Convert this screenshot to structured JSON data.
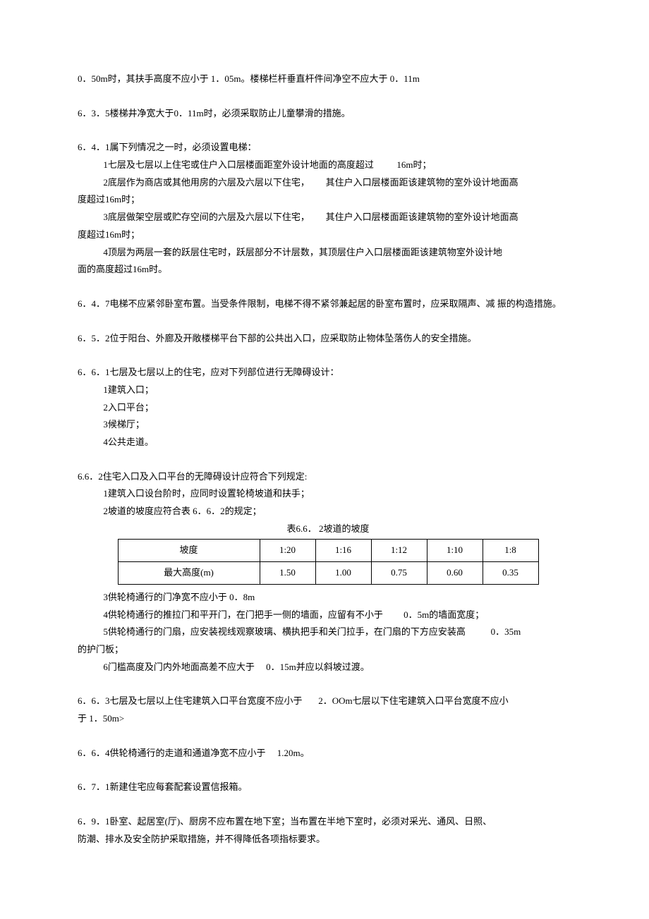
{
  "p1": "0．50m时，其扶手高度不应小于 1．05m。楼梯栏杆垂直杆件间净空不应大于 0．11m",
  "p2": "6．3．5楼梯井净宽大于0．11m时，必须采取防止儿童攀滑的措施。",
  "p3_head": "6．4．1属下列情况之一时，必须设置电梯：",
  "p3_1": "1七层及七层以上住宅或住户入口层楼面距室外设计地面的高度超过          16m时；",
  "p3_2a": "2底层作为商店或其他用房的六层及六层以下住宅，       其住户入口层楼面距该建筑物的室外设计地面高",
  "p3_2b": "度超过16m时；",
  "p3_3a": "3底层做架空层或贮存空间的六层及六层以下住宅，       其住户入口层楼面距该建筑物的室外设计地面高",
  "p3_3b": "度超过16m时；",
  "p3_4a": "4顶层为两层一套的跃层住宅时，跃层部分不计层数，其顶层住户入口层楼面距该建筑物室外设计地",
  "p3_4b": "面的高度超过16m时。",
  "p4": "6．4．7电梯不应紧邻卧室布置。当受条件限制，电梯不得不紧邻兼起居的卧室布置时，应采取隔声、减 振的构造措施。",
  "p5": "6．5．2位于阳台、外廊及开敞楼梯平台下部的公共出入口，应采取防止物体坠落伤人的安全措施。",
  "p6_head": "6．6．1七层及七层以上的住宅，应对下列部位进行无障碍设计：",
  "p6_1": "1建筑入口；",
  "p6_2": "2入口平台；",
  "p6_3": "3候梯厅；",
  "p6_4": "4公共走道。",
  "p7_head": "6.6．2住宅入口及入口平台的无障碍设计应符合下列规定:",
  "p7_1": "1建筑入口设台阶时，应同时设置轮椅坡道和扶手；",
  "p7_2": "2坡道的坡度应符合表 6．6．2的规定；",
  "table_caption": "表6.6． 2坡道的坡度",
  "table": {
    "row1": [
      "坡度",
      "1:20",
      "1:16",
      "1:12",
      "1:10",
      "1:8"
    ],
    "row2": [
      "最大高度(m)",
      "1.50",
      "1.00",
      "0.75",
      "0.60",
      "0.35"
    ]
  },
  "p7_3": "3供轮椅通行的门净宽不应小于 0．8m",
  "p7_4": "4供轮椅通行的推拉门和平开门，在门把手一侧的墙面，应留有不小于         0．5m的墙面宽度；",
  "p7_5a": "5供轮椅通行的门扇，应安装视线观察玻璃、横执把手和关门拉手，在门扇的下方应安装高           0．35m",
  "p7_5b": "的护门板；",
  "p7_6": "6门槛高度及门内外地面高差不应大于     0．15m并应以斜坡过渡。",
  "p8a": "6．6．3七层及七层以上住宅建筑入口平台宽度不应小于       2．OOm七层以下住宅建筑入口平台宽度不应小",
  "p8b": "于 1．50m>",
  "p9": "6．6．4供轮椅通行的走道和通道净宽不应小于     1.20m。",
  "p10": "6．7．1新建住宅应每套配套设置信报箱。",
  "p11a": "6．9．1卧室、起居室(厅)、厨房不应布置在地下室；当布置在半地下室时，必须对采光、通风、日照、",
  "p11b": "防潮、排水及安全防护采取措施，并不得降低各项指标要求。"
}
